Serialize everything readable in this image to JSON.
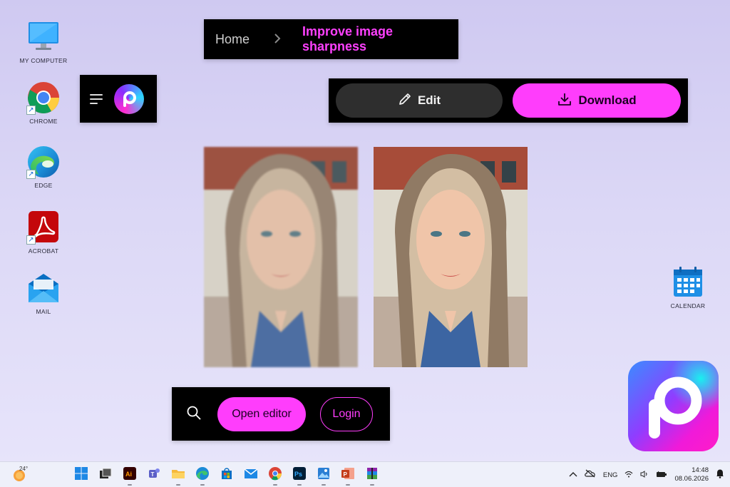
{
  "desktop": {
    "icons": [
      {
        "label": "MY COMPUTER",
        "icon": "monitor-icon"
      },
      {
        "label": "CHROME",
        "icon": "chrome-icon"
      },
      {
        "label": "EDGE",
        "icon": "edge-icon"
      },
      {
        "label": "ACROBAT",
        "icon": "acrobat-icon"
      },
      {
        "label": "MAIL",
        "icon": "mail-icon"
      },
      {
        "label": "CALENDAR",
        "icon": "calendar-icon"
      }
    ]
  },
  "breadcrumb": {
    "home": "Home",
    "separator_icon": "chevron-right-icon",
    "current": "Improve image sharpness"
  },
  "header": {
    "menu_icon": "hamburger-icon",
    "logo_icon": "picsart-logo-icon"
  },
  "actions": {
    "edit_label": "Edit",
    "edit_icon": "pencil-icon",
    "download_label": "Download",
    "download_icon": "download-icon"
  },
  "comparison": {
    "images": [
      {
        "name": "before-image",
        "state": "blurred"
      },
      {
        "name": "after-image",
        "state": "sharpened"
      }
    ]
  },
  "bottom_bar": {
    "search_icon": "search-icon",
    "open_editor_label": "Open editor",
    "login_label": "Login"
  },
  "taskbar": {
    "weather_temp": "24°",
    "apps": [
      "windows-start-icon",
      "task-view-icon",
      "illustrator-icon",
      "teams-icon",
      "file-explorer-icon",
      "edge-icon",
      "store-icon",
      "mail-icon",
      "chrome-icon",
      "photoshop-icon",
      "photos-icon",
      "powerpoint-icon",
      "winrar-icon"
    ],
    "tray": {
      "language": "ENG",
      "time": "14:48",
      "date": "08.06.2026"
    }
  },
  "colors": {
    "accent": "#ff3dfc",
    "panel": "#000000",
    "edit_button": "#2e2e2e",
    "desktop_bg": "#d8d4f5"
  }
}
